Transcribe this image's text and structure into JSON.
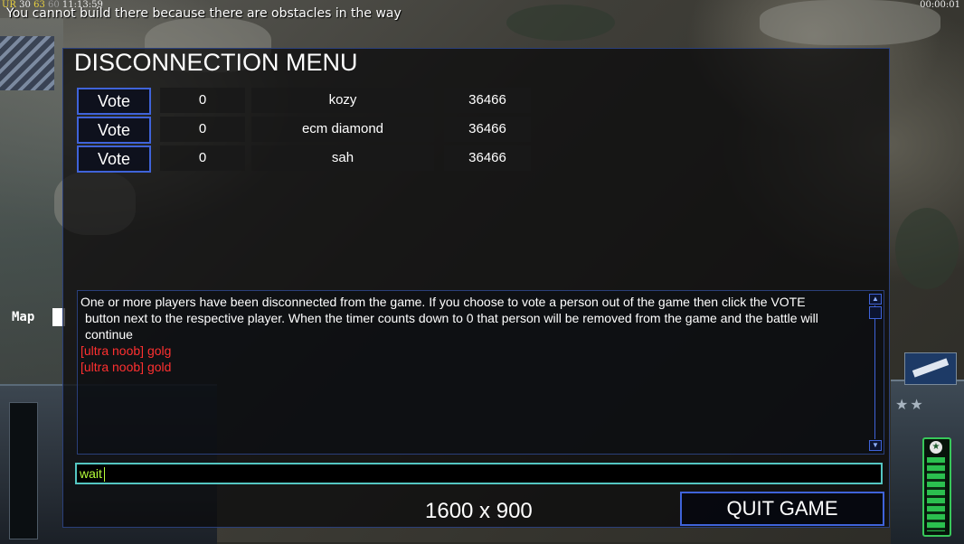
{
  "top_overlay": {
    "stats_1": "UR",
    "stats_2": "30",
    "stats_3": "63",
    "stats_4": "60",
    "stats_5": "11:13:59",
    "warning": "You cannot build there because there are obstacles in the way",
    "game_timer": "00:00:01"
  },
  "map_label": "Map",
  "dialog": {
    "title": "DISCONNECTION MENU",
    "vote_label": "Vote",
    "players": [
      {
        "count": "0",
        "name": "kozy",
        "id": "36466"
      },
      {
        "count": "0",
        "name": "ecm diamond",
        "id": "36466"
      },
      {
        "count": "0",
        "name": "sah",
        "id": "36466"
      }
    ],
    "log": {
      "message_line1": "One or more players have been disconnected from the game. If you choose to vote a person out of the game then click the VOTE",
      "message_line2": "button next to the respective player. When the timer counts down to 0 that person will be removed from the game and the battle will",
      "message_line3": "continue",
      "chat_lines": [
        "[ultra noob] golg",
        "[ultra noob] gold"
      ]
    },
    "chat_input_value": "wait",
    "resolution": "1600 x 900",
    "quit_label": "QUIT GAME"
  },
  "colors": {
    "dialog_border": "#2a3f7a",
    "button_border": "#3f63d9",
    "chat_red": "#ff3030",
    "input_text": "#b6ff3a",
    "input_border": "#54c6c2"
  }
}
